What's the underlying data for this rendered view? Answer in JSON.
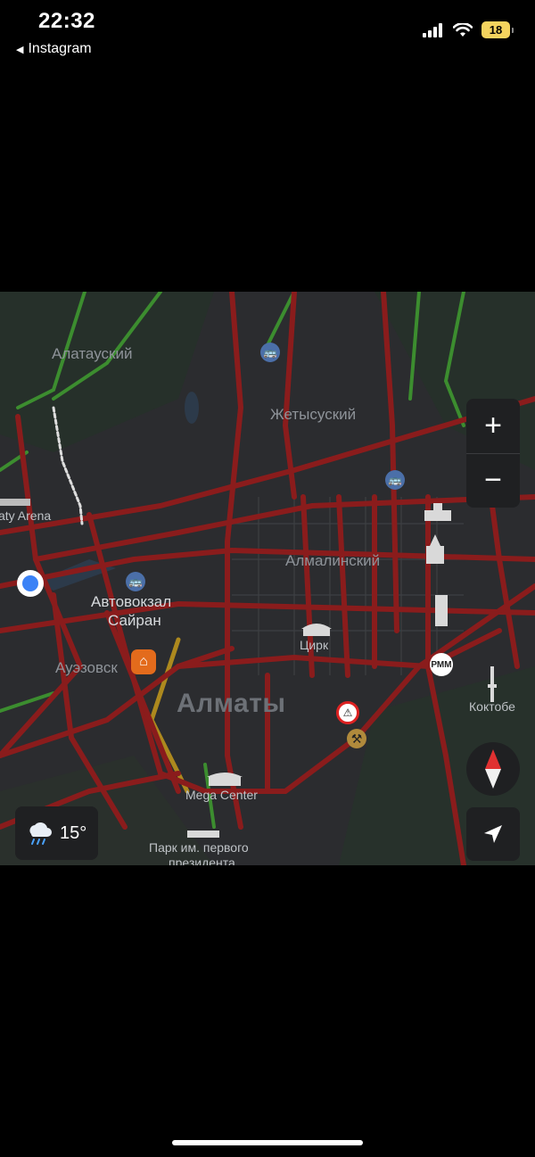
{
  "status": {
    "time": "22:32",
    "back_label": "Instagram",
    "battery": "18"
  },
  "map": {
    "districts": [
      "Алатауский",
      "Жетысуский",
      "Алмалинский",
      "Ауэзовск"
    ],
    "places": [
      "aty Arena",
      "Автовокзал",
      "Сайран",
      "Цирк",
      "Коктобе",
      "Mega Center",
      "Парк им. первого",
      "президента"
    ],
    "city": "Алматы",
    "poi": {
      "rmm": "РММ"
    },
    "weather": {
      "temp": "15°",
      "icon": "rain-cloud-icon"
    },
    "controls": {
      "zoom_in": "+",
      "zoom_out": "−"
    }
  },
  "colors": {
    "traffic_heavy": "#8a1c1c",
    "traffic_medium": "#d6a81f",
    "traffic_free": "#3c8d2f",
    "map_bg": "#2b2c2f"
  }
}
